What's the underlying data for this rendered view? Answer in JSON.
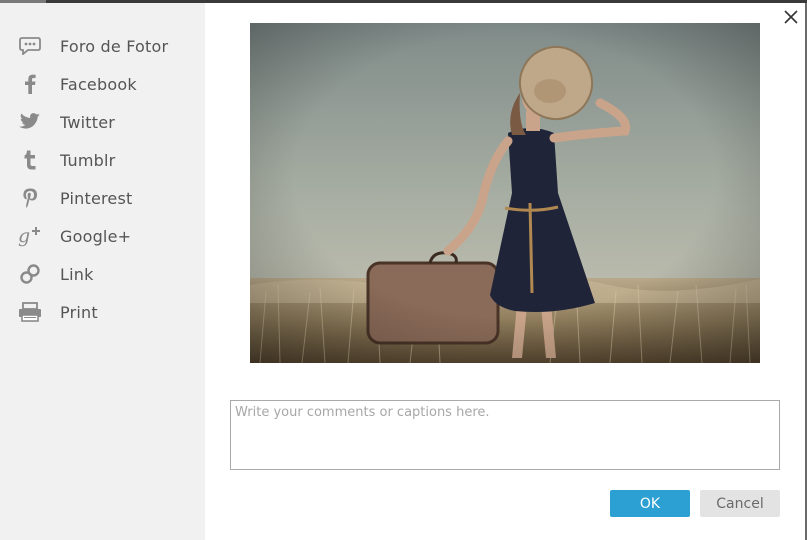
{
  "sidebar": {
    "items": [
      {
        "label": "Foro de Fotor",
        "icon": "speech-bubble-icon"
      },
      {
        "label": "Facebook",
        "icon": "facebook-icon"
      },
      {
        "label": "Twitter",
        "icon": "twitter-bird-icon"
      },
      {
        "label": "Tumblr",
        "icon": "tumblr-icon"
      },
      {
        "label": "Pinterest",
        "icon": "pinterest-icon"
      },
      {
        "label": "Google+",
        "icon": "google-plus-icon"
      },
      {
        "label": "Link",
        "icon": "chain-link-icon"
      },
      {
        "label": "Print",
        "icon": "printer-icon"
      }
    ]
  },
  "dialog": {
    "close_icon": "close-icon",
    "photo": {
      "subject": "woman-in-wheat-field-with-suitcase"
    },
    "comment": {
      "placeholder": "Write your comments or captions here.",
      "value": ""
    },
    "ok_label": "OK",
    "cancel_label": "Cancel"
  },
  "colors": {
    "accent": "#2c9fd3",
    "sidebar_bg": "#f1f1f1",
    "icon_gray": "#8a8a8a",
    "text_gray": "#555555",
    "cancel_bg": "#e3e3e3"
  }
}
